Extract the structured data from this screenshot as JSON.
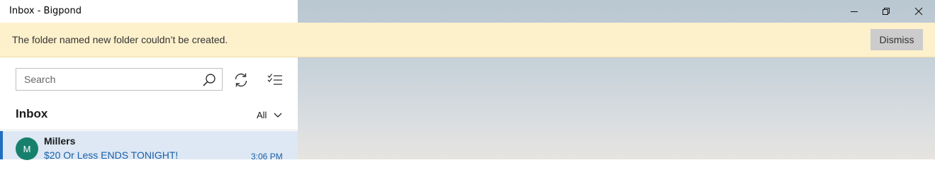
{
  "window": {
    "title": "Inbox - Bigpond",
    "controls": [
      "minimize-icon",
      "restore-icon",
      "close-icon"
    ]
  },
  "notification": {
    "message": "The folder named new folder couldn’t be created.",
    "dismiss_label": "Dismiss"
  },
  "search": {
    "placeholder": "Search",
    "icon": "search-icon"
  },
  "toolbar": {
    "sync_icon": "sync-icon",
    "select_icon": "selection-mode-icon"
  },
  "folder": {
    "title": "Inbox",
    "filter_label": "All"
  },
  "messages": [
    {
      "avatar_initial": "M",
      "sender": "Millers",
      "subject": "$20 Or Less ENDS TONIGHT!",
      "time": "3:06 PM"
    }
  ],
  "colors": {
    "notification_bg": "#fdf1cc",
    "accent": "#1f6ec1",
    "selected_item_bg": "#dde8f4",
    "avatar_bg": "#17806c",
    "subject_text": "#1a5fa8"
  }
}
